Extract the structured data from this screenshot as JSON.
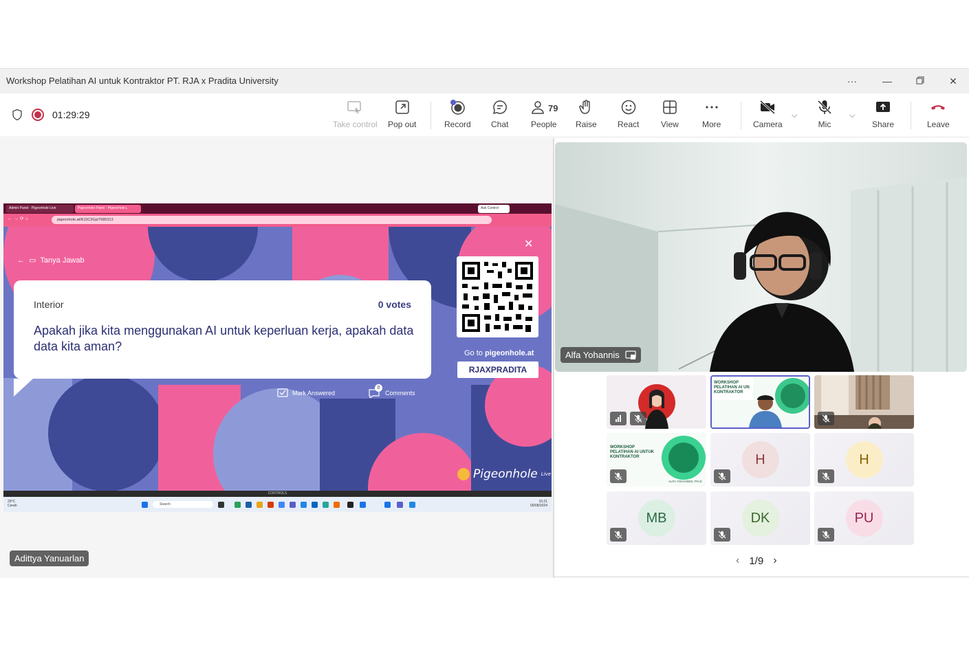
{
  "window": {
    "title": "Workshop Pelatihan AI untuk Kontraktor PT. RJA x Pradita University",
    "more_icon": "ellipsis-icon",
    "minimize_icon": "minimize-icon",
    "restore_icon": "restore-icon",
    "close_icon": "close-icon"
  },
  "toolbar": {
    "timer": "01:29:29",
    "take_control": "Take control",
    "pop_out": "Pop out",
    "record": "Record",
    "chat": "Chat",
    "people": "People",
    "people_count": "79",
    "raise": "Raise",
    "react": "React",
    "view": "View",
    "more": "More",
    "camera": "Camera",
    "mic": "Mic",
    "share": "Share",
    "leave": "Leave",
    "leave_color": "#c4314b",
    "record_color": "#c4314b"
  },
  "shared_screen": {
    "browser_tabs": [
      "Admin Panel - Pigeonhole Live",
      "Pigeonhole Panel - Pigeonhole L"
    ],
    "ask_control": "Ask Control",
    "url": "pigeonhole.at/RJ3C3Gp/7685313",
    "back_label": "Tanya Jawab",
    "question": {
      "category": "Interior",
      "votes": "0 votes",
      "text": "Apakah jika kita menggunakan AI untuk keperluan kerja, apakah data data kita aman?"
    },
    "goto_prefix": "Go to",
    "goto_site": "pigeonhole.at",
    "event_code": "RJAXPRADITA",
    "mark_answered": "Mark Answered",
    "comments": "Comments",
    "comments_count": "0",
    "brand": "Pigeonhole",
    "brand_sup": "Live",
    "controls_label": "CONTROLS",
    "taskbar": {
      "weather_temp": "29°C",
      "weather_desc": "Cerah",
      "search": "Search",
      "time": "15:21",
      "date": "09/08/2024"
    },
    "colors": {
      "pink": "#f0619b",
      "navy": "#3f4a96",
      "purple": "#6b74c4",
      "lavender": "#8e9ad8"
    }
  },
  "presenter_name": "Adittya Yanuarlan",
  "main_video": {
    "name": "Alfa Yohannis"
  },
  "participants": [
    {
      "initials": "",
      "kind": "video-woman",
      "muted": true,
      "speaking_bars": true
    },
    {
      "initials": "",
      "kind": "video-workshop",
      "muted": false,
      "active": true,
      "banner": "WORKSHOP PELATIHAN AI UNTUK KONTRAKTOR"
    },
    {
      "initials": "",
      "kind": "video-room",
      "muted": true
    },
    {
      "initials": "",
      "kind": "video-slide",
      "muted": true,
      "banner": "WORKSHOP PELATIHAN AI UNTUK KONTRAKTOR",
      "sub": "ALFA YOHANNIS, PH.D"
    },
    {
      "initials": "H",
      "kind": "avatar",
      "muted": true,
      "bg": "#f1dfe0",
      "fg": "#8a3b3b"
    },
    {
      "initials": "H",
      "kind": "avatar",
      "muted": true,
      "bg": "#fbeec6",
      "fg": "#8a5e00"
    },
    {
      "initials": "MB",
      "kind": "avatar",
      "muted": true,
      "bg": "#dcefe3",
      "fg": "#2d6b45"
    },
    {
      "initials": "DK",
      "kind": "avatar",
      "muted": true,
      "bg": "#e4f1de",
      "fg": "#3c6a2d"
    },
    {
      "initials": "PU",
      "kind": "avatar",
      "muted": true,
      "bg": "#f9dde6",
      "fg": "#9b2250"
    }
  ],
  "pager": {
    "label": "1/9"
  }
}
